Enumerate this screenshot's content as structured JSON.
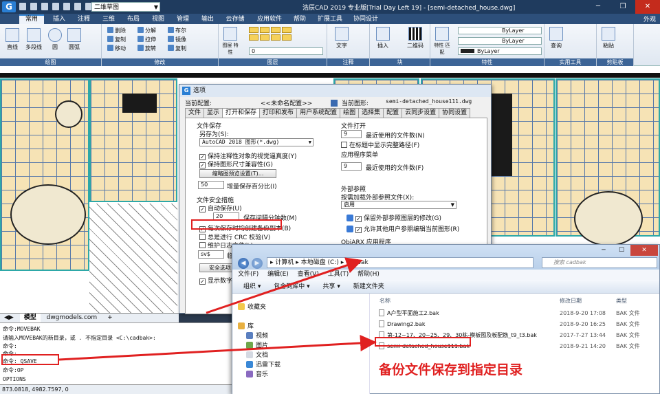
{
  "titlebar": {
    "app_icon": "G",
    "workspace": "二维草图",
    "title": "浩辰CAD 2019 专业版[Trial Day Left 19] - [semi-detached_house.dwg]"
  },
  "ribbon_tabs": [
    "常用",
    "插入",
    "注释",
    "三维",
    "布局",
    "视图",
    "管理",
    "输出",
    "云存储",
    "应用软件",
    "帮助",
    "扩展工具",
    "协同设计"
  ],
  "ribbon_right": "外观",
  "ribbon": {
    "draw": {
      "line": "直线",
      "polyline": "多段线",
      "circle": "圆",
      "arc": "圆弧",
      "label": "绘图"
    },
    "modify": {
      "erase": "删除",
      "copy_obj": "复制",
      "stretch": "拉伸",
      "move": "移动",
      "explode": "分解",
      "mirror": "镜像",
      "rotate": "旋转",
      "copy": "复制",
      "fillet": "布尔",
      "label": "修改"
    },
    "layer": {
      "props": "图层\n特性",
      "current": "0",
      "label": "图层"
    },
    "annotation": {
      "text": "文字",
      "label": "注释"
    },
    "block": {
      "insert": "插入",
      "qrcode": "二维码",
      "label": "块"
    },
    "properties": {
      "match": "特性\n匹配",
      "bylayer": "ByLayer",
      "label": "特性"
    },
    "utilities": {
      "query": "查询",
      "label": "实用工具"
    },
    "clipboard": {
      "paste": "粘贴",
      "label": "剪贴板"
    }
  },
  "layout_tabs": [
    "模型",
    "dwgmodels.com",
    "+"
  ],
  "command_lines": [
    "命令:MOVEBAK",
    "请输入MOVEBAK的新目录，或 . 不指定目录 <C:\\cadbak>:",
    "命令:",
    "命令:",
    "命令: QSAVE",
    "命令:OP",
    "OPTIONS"
  ],
  "status_coords": "873.0818, 4982.7597, 0",
  "dialog": {
    "title": "选项",
    "current_config_label": "当前配置:",
    "current_config_value": "<<未命名配置>>",
    "current_drawing_label": "当前图形:",
    "current_drawing_value": "semi-detached_house111.dwg",
    "tabs": [
      "文件",
      "显示",
      "打开和保存",
      "打印和发布",
      "用户系统配置",
      "绘图",
      "选择集",
      "配置",
      "云同步设置",
      "协同设置"
    ],
    "active_tab": "打开和保存",
    "file_save": {
      "header": "文件保存",
      "save_as_label": "另存为(S):",
      "save_as_value": "AutoCAD 2018 图形(*.dwg)",
      "keep_annot": "保持注释性对象的视觉逼真度(Y)",
      "keep_size": "保持图形尺寸兼容性(G)",
      "thumbnail_btn": "缩略图预览设置(T)...",
      "incr_value": "50",
      "incr_label": "增量保存百分比(I)"
    },
    "safety": {
      "header": "文件安全措施",
      "autosave": "自动保存(U)",
      "interval_value": "20",
      "interval_label": "保存间隔分钟数(M)",
      "backup": "每次保存时均创建备份副本(B)",
      "crc": "总是进行 CRC 校验(V)",
      "log": "维护日志文件(L)",
      "ext_value": "sv$",
      "ext_label": "临时文件",
      "security_btn": "安全选项",
      "digital_sig": "显示数字签名"
    },
    "file_open": {
      "header": "文件打开",
      "recent_value": "9",
      "recent_label": "最近使用的文件数(N)",
      "fullpath": "在标题中显示完整路径(F)"
    },
    "app_menu": {
      "header": "应用程序菜单",
      "recent_value": "9",
      "recent_label": "最近使用的文件数(F)"
    },
    "xref": {
      "header": "外部参照",
      "demand_label": "按需加载外部参照文件(X):",
      "demand_value": "启用",
      "retain": "保留外部参照图层的修改(G)",
      "allow": "允许其他用户参照编辑当前图形(R)",
      "objarx": "ObjARX 应用程序"
    }
  },
  "explorer": {
    "address": [
      "计算机",
      "本地磁盘 (C:)",
      "cadbak"
    ],
    "search_placeholder": "搜索 cadbak",
    "menu": [
      "文件(F)",
      "编辑(E)",
      "查看(V)",
      "工具(T)",
      "帮助(H)"
    ],
    "toolbar": [
      "组织 ▾",
      "包含到库中 ▾",
      "共享 ▾",
      "新建文件夹"
    ],
    "nav": [
      "收藏夹",
      "库",
      "视频",
      "图片",
      "文档",
      "迅雷下载",
      "音乐"
    ],
    "columns": [
      "名称",
      "修改日期",
      "类型"
    ],
    "files": [
      {
        "name": "A户型平面施工2.bak",
        "date": "2018-9-20 17:08",
        "type": "BAK 文件"
      },
      {
        "name": "Drawing2.bak",
        "date": "2018-9-20 16:25",
        "type": "BAK 文件"
      },
      {
        "name": "第-12~17、20~25、29、30栋-模板图及板配筋_t9_t3.bak",
        "date": "2017-7-27 13:44",
        "type": "BAK 文件"
      },
      {
        "name": "semi-detached_house111.bak",
        "date": "2018-9-21 14:20",
        "type": "BAK 文件"
      }
    ]
  },
  "annotation_text": "备份文件保存到指定目录",
  "colors": {
    "annotation": "#e02020",
    "ribbon_group_label": "#3c6496",
    "titlebar": "#1f3b5e"
  }
}
